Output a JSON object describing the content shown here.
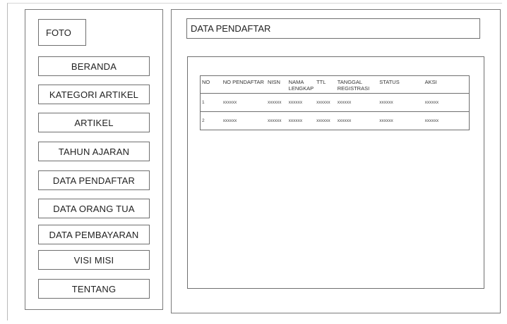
{
  "sidebar": {
    "photo_label": "FOTO",
    "items": [
      {
        "label": "BERANDA"
      },
      {
        "label": "KATEGORI ARTIKEL"
      },
      {
        "label": "ARTIKEL"
      },
      {
        "label": "TAHUN AJARAN"
      },
      {
        "label": "DATA PENDAFTAR"
      },
      {
        "label": "DATA ORANG TUA"
      },
      {
        "label": "DATA PEMBAYARAN"
      },
      {
        "label": "VISI MISI"
      },
      {
        "label": "TENTANG"
      }
    ]
  },
  "main": {
    "title": "DATA PENDAFTAR",
    "table": {
      "columns": [
        "NO",
        "NO PENDAFTAR",
        "NISN",
        "NAMA LENGKAP",
        "TTL",
        "TANGGAL REGISTRASI",
        "STATUS",
        "AKSI"
      ],
      "rows": [
        [
          "1",
          "xxxxxx",
          "xxxxxx",
          "xxxxxx",
          "xxxxxx",
          "xxxxxx",
          "xxxxxx",
          "xxxxxx"
        ],
        [
          "2",
          "xxxxxx",
          "xxxxxx",
          "xxxxxx",
          "xxxxxx",
          "xxxxxx",
          "xxxxxx",
          "xxxxxx"
        ]
      ]
    }
  }
}
